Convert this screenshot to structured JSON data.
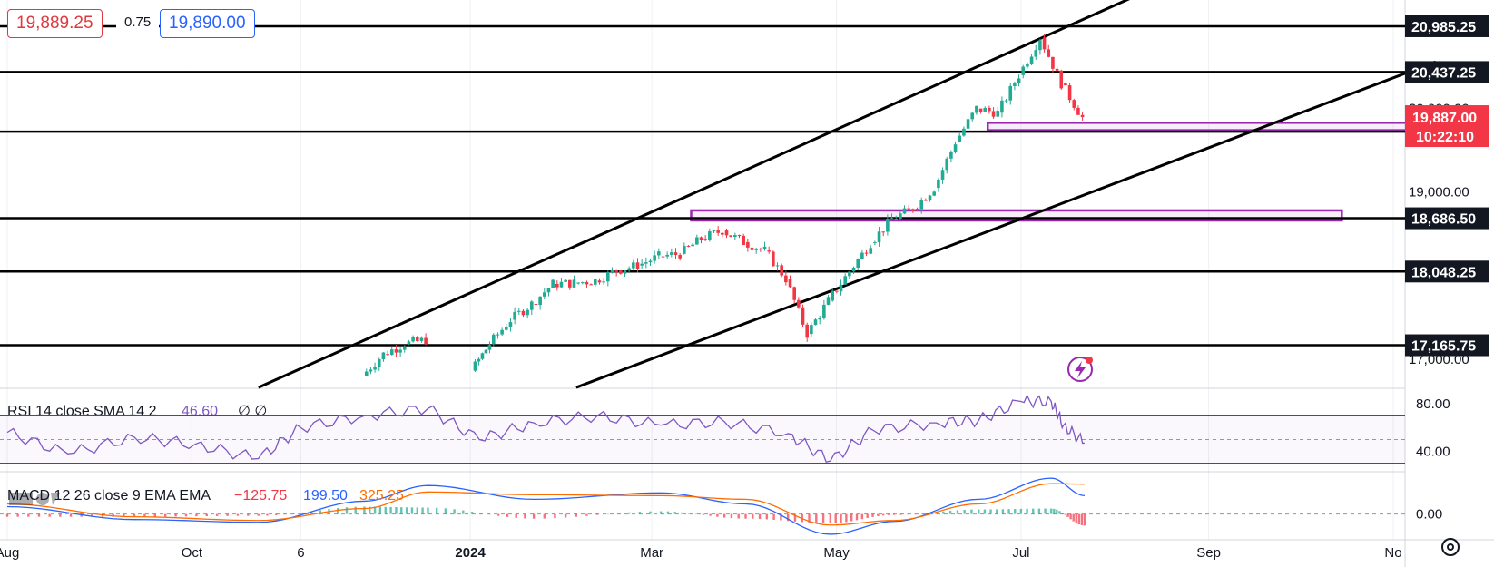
{
  "quote": {
    "bid": "19,889.25",
    "spread": "0.75",
    "ask": "19,890.00"
  },
  "colors": {
    "up": "#22ab94",
    "down": "#f23645",
    "rsi": "#7e57c2",
    "macd": "#2962ff",
    "signal": "#ff6d00",
    "zone": "#9c27b0",
    "last_price": "#f23645"
  },
  "icons": [
    "flash-alert-icon",
    "settings-icon"
  ],
  "chart_data": [
    {
      "type": "candlestick",
      "x_ticks": [
        "Aug",
        "Oct",
        "6",
        "2024",
        "Mar",
        "May",
        "Jul",
        "Sep",
        "No"
      ],
      "y_ticks": [
        "20,000.00",
        "19,000.00",
        "17,000.00"
      ],
      "ylim": [
        16650,
        21300
      ],
      "horizontal_levels": [
        "20,985.25",
        "20,437.25",
        "19,723.00",
        "18,686.50",
        "18,048.25",
        "17,165.75"
      ],
      "last_price": "19,887.00",
      "countdown": "10:22:10",
      "zones": [
        {
          "from": "Jun 20, 2024",
          "to": "Nov 2024",
          "low": 19740,
          "high": 19830
        },
        {
          "from": "Mar 14, 2024",
          "to": "Oct 2024",
          "low": 18660,
          "high": 18780
        }
      ],
      "channel": [
        {
          "from": [
            "Oct 23, 2023",
            16660
          ],
          "to": [
            "Aug 8, 2024",
            21350
          ]
        },
        {
          "from": [
            "Feb 5, 2024",
            16660
          ],
          "to": [
            "Nov 2024",
            20560
          ]
        }
      ],
      "closes": [
        [
          [
            "Nov 27, 2023",
            16800
          ],
          [
            "Dec 4, 2023",
            17060
          ],
          [
            "Dec 11, 2023",
            17180
          ],
          [
            "Dec 18, 2023",
            17230
          ]
        ],
        [
          [
            "Jan 2, 2024",
            16860
          ],
          [
            "Jan 8, 2024",
            17180
          ],
          [
            "Jan 15, 2024",
            17470
          ],
          [
            "Jan 22, 2024",
            17660
          ],
          [
            "Jan 29, 2024",
            17900
          ],
          [
            "Feb 5, 2024",
            17910
          ],
          [
            "Feb 12, 2024",
            17940
          ],
          [
            "Feb 19, 2024",
            18060
          ],
          [
            "Feb 26, 2024",
            18120
          ],
          [
            "Mar 4, 2024",
            18230
          ],
          [
            "Mar 11, 2024",
            18260
          ],
          [
            "Mar 18, 2024",
            18440
          ],
          [
            "Mar 25, 2024",
            18540
          ],
          [
            "Apr 1, 2024",
            18400
          ],
          [
            "Apr 8, 2024",
            18300
          ],
          [
            "Apr 15, 2024",
            17960
          ],
          [
            "Apr 22, 2024",
            17300
          ],
          [
            "Apr 29, 2024",
            17700
          ],
          [
            "May 6, 2024",
            18050
          ],
          [
            "May 13, 2024",
            18390
          ],
          [
            "May 20, 2024",
            18680
          ],
          [
            "May 27, 2024",
            18800
          ],
          [
            "Jun 3, 2024",
            19050
          ],
          [
            "Jun 10, 2024",
            19600
          ],
          [
            "Jun 17, 2024",
            20000
          ],
          [
            "Jun 24, 2024",
            19950
          ],
          [
            "Jul 1, 2024",
            20400
          ],
          [
            "Jul 8, 2024",
            20850
          ],
          [
            "Jul 15, 2024",
            20300
          ],
          [
            "Jul 22, 2024",
            19890
          ]
        ]
      ]
    },
    {
      "type": "line",
      "title": "RSI 14 close SMA 14 2",
      "value": "46.60",
      "extra": "∅ ∅",
      "y_ticks": [
        "80.00",
        "40.00"
      ],
      "ylim": [
        23,
        93
      ],
      "levels": [
        70,
        50,
        30
      ],
      "x": [
        "Aug 1, 2023",
        "Aug 21, 2023",
        "Sep 12, 2023",
        "Oct 2, 2023",
        "Oct 23, 2023",
        "Nov 6, 2023",
        "Nov 27, 2023",
        "Dec 18, 2023",
        "Jan 4, 2024",
        "Jan 22, 2024",
        "Feb 12, 2024",
        "Mar 4, 2024",
        "Mar 25, 2024",
        "Apr 15, 2024",
        "Apr 29, 2024",
        "May 13, 2024",
        "Jun 3, 2024",
        "Jun 17, 2024",
        "Jul 1, 2024",
        "Jul 11, 2024",
        "Jul 15, 2024",
        "Jul 22, 2024"
      ],
      "values": [
        56,
        38,
        52,
        46,
        34,
        60,
        70,
        76,
        50,
        64,
        70,
        62,
        65,
        55,
        32,
        58,
        64,
        66,
        82,
        82,
        62,
        47
      ]
    },
    {
      "type": "histogram+line",
      "title": "MACD 12 26 close 9 EMA EMA",
      "values_shown": [
        "−125.75",
        "199.50",
        "325.25"
      ],
      "y_ticks": [
        "0.00"
      ],
      "ylim": [
        -280,
        460
      ],
      "x": [
        "Aug 1, 2023",
        "Sep 12, 2023",
        "Oct 23, 2023",
        "Nov 27, 2023",
        "Dec 18, 2023",
        "Jan 22, 2024",
        "Mar 4, 2024",
        "Apr 1, 2024",
        "Apr 29, 2024",
        "May 20, 2024",
        "Jun 17, 2024",
        "Jul 11, 2024",
        "Jul 22, 2024"
      ],
      "series": [
        {
          "name": "MACD",
          "values": [
            80,
            -60,
            -90,
            140,
            310,
            160,
            230,
            110,
            -220,
            -80,
            160,
            390,
            200
          ]
        },
        {
          "name": "Signal",
          "values": [
            110,
            -30,
            -70,
            60,
            240,
            210,
            200,
            160,
            -120,
            -70,
            110,
            330,
            325
          ]
        }
      ]
    }
  ]
}
